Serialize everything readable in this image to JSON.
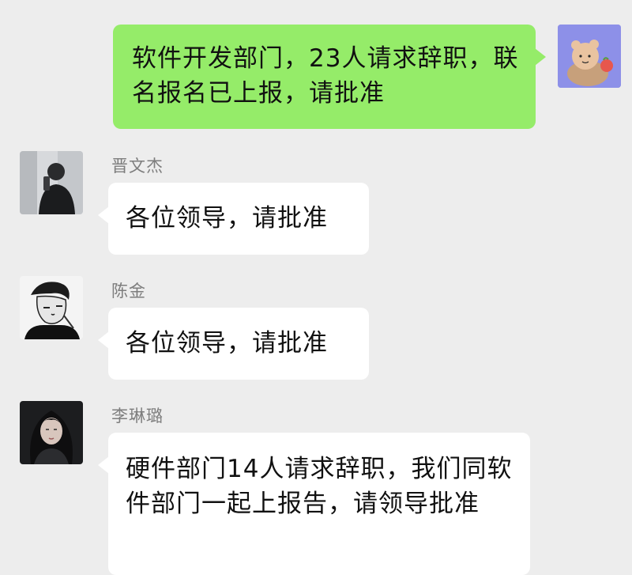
{
  "messages": [
    {
      "sender": "",
      "text": "软件开发部门，23人请求辞职，联名报名已上报，请批准",
      "direction": "outgoing",
      "avatar_icon": "bear-avatar-icon"
    },
    {
      "sender": "晋文杰",
      "text": "各位领导，请批准",
      "direction": "incoming",
      "avatar_icon": "person-avatar-icon"
    },
    {
      "sender": "陈金",
      "text": "各位领导，请批准",
      "direction": "incoming",
      "avatar_icon": "sketch-portrait-avatar-icon"
    },
    {
      "sender": "李琳璐",
      "text": "硬件部门14人请求辞职，我们同软件部门一起上报告，请领导批准",
      "direction": "incoming",
      "avatar_icon": "woman-avatar-icon"
    }
  ],
  "colors": {
    "background": "#ededed",
    "incoming_bubble": "#ffffff",
    "outgoing_bubble": "#95ec69",
    "sender_name": "#7d7d7d"
  }
}
